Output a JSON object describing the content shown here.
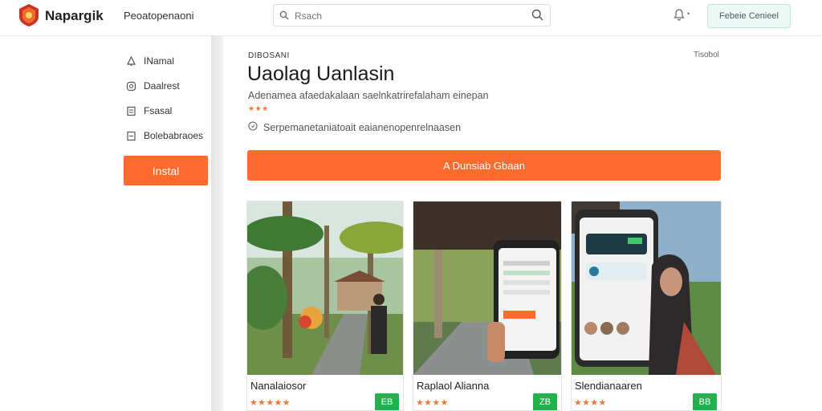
{
  "header": {
    "app_name": "Napargik",
    "nav_title": "Peoatopenaoni",
    "search_placeholder": "Rsach",
    "action_button": "Febeie Cenieel",
    "logo_icon": "shield-logo-icon",
    "accent_color": "#ff6b2c"
  },
  "sidebar": {
    "items": [
      {
        "label": "INamal",
        "icon": "drop-icon"
      },
      {
        "label": "Daalrest",
        "icon": "chat-icon"
      },
      {
        "label": "Fsasal",
        "icon": "document-icon"
      },
      {
        "label": "Bolebabraoes",
        "icon": "list-icon"
      }
    ],
    "install_label": "Instal"
  },
  "main": {
    "breadcrumb": "DIBOSANI",
    "top_right_label": "Tisobol",
    "title": "Uaolag Uanlasin",
    "subtitle": "Adenamea afaedakalaan saelnkatrirefalaham einepan",
    "stars": "★★★",
    "info": "Serpemanetaniatoait eaianenopenrelnaasen",
    "cta_label": "A   Dunsiab Gbaan"
  },
  "cards": [
    {
      "name": "Nanalaiosor",
      "stars": "★★★★★",
      "button": "EB",
      "scene": "garden-photo"
    },
    {
      "name": "Raplaol Alianna",
      "stars": "★★★★",
      "button": "ZB",
      "scene": "phone-in-garden-photo"
    },
    {
      "name": "Slendianaaren",
      "stars": "★★★★",
      "button": "BB",
      "scene": "phone-and-person-photo"
    }
  ]
}
